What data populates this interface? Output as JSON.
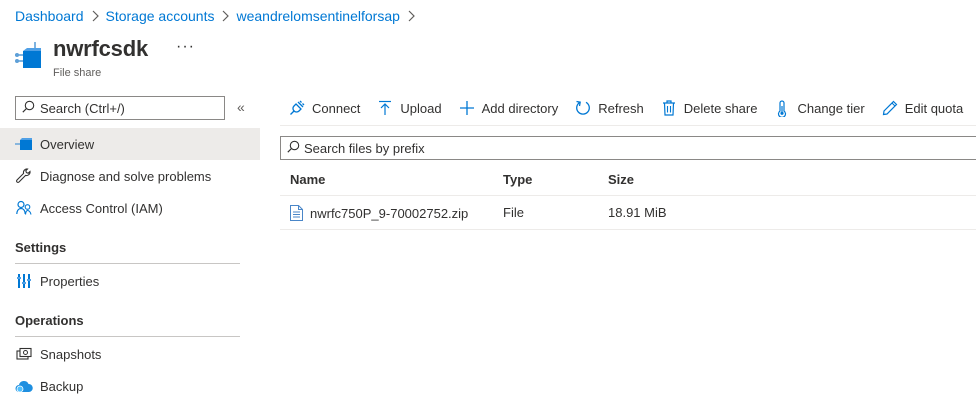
{
  "breadcrumb": {
    "items": [
      "Dashboard",
      "Storage accounts",
      "weandrelomsentinelforsap"
    ]
  },
  "header": {
    "title": "nwrfcsdk",
    "subtitle": "File share",
    "more": "···"
  },
  "sidebar": {
    "search_placeholder": "Search (Ctrl+/)",
    "collapse": "«",
    "items": [
      {
        "label": "Overview",
        "icon": "file-share-icon"
      },
      {
        "label": "Diagnose and solve problems",
        "icon": "wrench-icon"
      },
      {
        "label": "Access Control (IAM)",
        "icon": "people-icon"
      }
    ],
    "sections": [
      {
        "title": "Settings",
        "items": [
          {
            "label": "Properties",
            "icon": "properties-icon"
          }
        ]
      },
      {
        "title": "Operations",
        "items": [
          {
            "label": "Snapshots",
            "icon": "snapshots-icon"
          },
          {
            "label": "Backup",
            "icon": "backup-cloud-icon"
          }
        ]
      }
    ]
  },
  "toolbar": {
    "connect": "Connect",
    "upload": "Upload",
    "add_directory": "Add directory",
    "refresh": "Refresh",
    "delete_share": "Delete share",
    "change_tier": "Change tier",
    "edit_quota": "Edit quota"
  },
  "files": {
    "search_placeholder": "Search files by prefix",
    "columns": [
      "Name",
      "Type",
      "Size"
    ],
    "rows": [
      {
        "name": "nwrfc750P_9-70002752.zip",
        "type": "File",
        "size": "18.91 MiB"
      }
    ]
  },
  "colors": {
    "accent": "#0078d4",
    "active_bg": "#edebe9",
    "text": "#323130"
  }
}
